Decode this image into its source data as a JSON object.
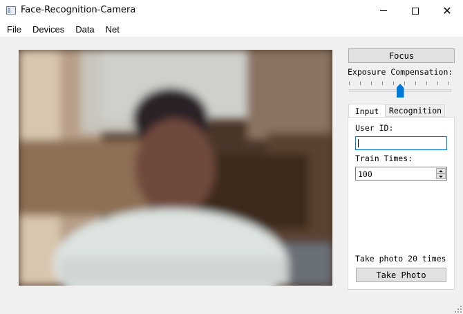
{
  "window": {
    "title": "Face-Recognition-Camera",
    "minimize_icon": "minimize-icon",
    "maximize_icon": "maximize-icon",
    "close_icon": "close-icon",
    "close_glyph": "✕"
  },
  "menu": {
    "items": [
      {
        "label": "File"
      },
      {
        "label": "Devices"
      },
      {
        "label": "Data"
      },
      {
        "label": "Net"
      }
    ]
  },
  "controls": {
    "focus_label": "Focus",
    "exposure_label": "Exposure Compensation:",
    "exposure_level": 0.5
  },
  "tabs": [
    {
      "label": "Input",
      "active": true
    },
    {
      "label": "Recognition",
      "active": false
    }
  ],
  "input_tab": {
    "user_id_label": "User ID:",
    "user_id_value": "",
    "train_times_label": "Train Times:",
    "train_times_value": "100",
    "photo_info": "Take photo 20 times",
    "take_photo_label": "Take Photo"
  },
  "colors": {
    "accent": "#0078d7",
    "background": "#f0f0f0",
    "button_face": "#e1e1e1"
  }
}
